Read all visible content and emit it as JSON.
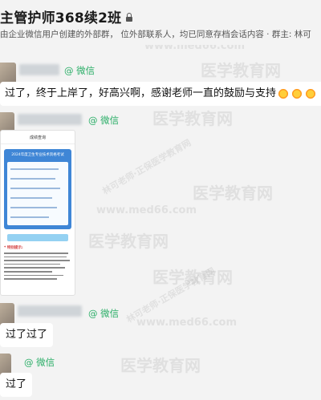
{
  "header": {
    "title": "主管护师368续2班",
    "notice": "由企业微信用户创建的外部群，        位外部联系人，均已同意存档会话内容 · 群主: 林可"
  },
  "messages": [
    {
      "tag": "@ 微信",
      "text": "过了，终于上岸了，好高兴啊，感谢老师一直的鼓励与支持",
      "emoji_count": 3,
      "emoji_icon": "sun-face-emoji"
    },
    {
      "tag": "@ 微信",
      "image": {
        "top_title": "成绩查询",
        "form_title": "2024年度卫生专业技术资格考试",
        "notes_title": "* 特别提示:"
      }
    },
    {
      "tag": "@ 微信",
      "text": "过了过了"
    },
    {
      "tag": "@ 微信",
      "text": "过了"
    }
  ],
  "watermark": {
    "brand": "医学教育网",
    "site": "www.med66.com",
    "teacher": "林可老师·正保医学教育网"
  },
  "colors": {
    "wechat_green": "#2aae67",
    "chat_bg": "#f3f3f3",
    "bubble_bg": "#ffffff"
  }
}
